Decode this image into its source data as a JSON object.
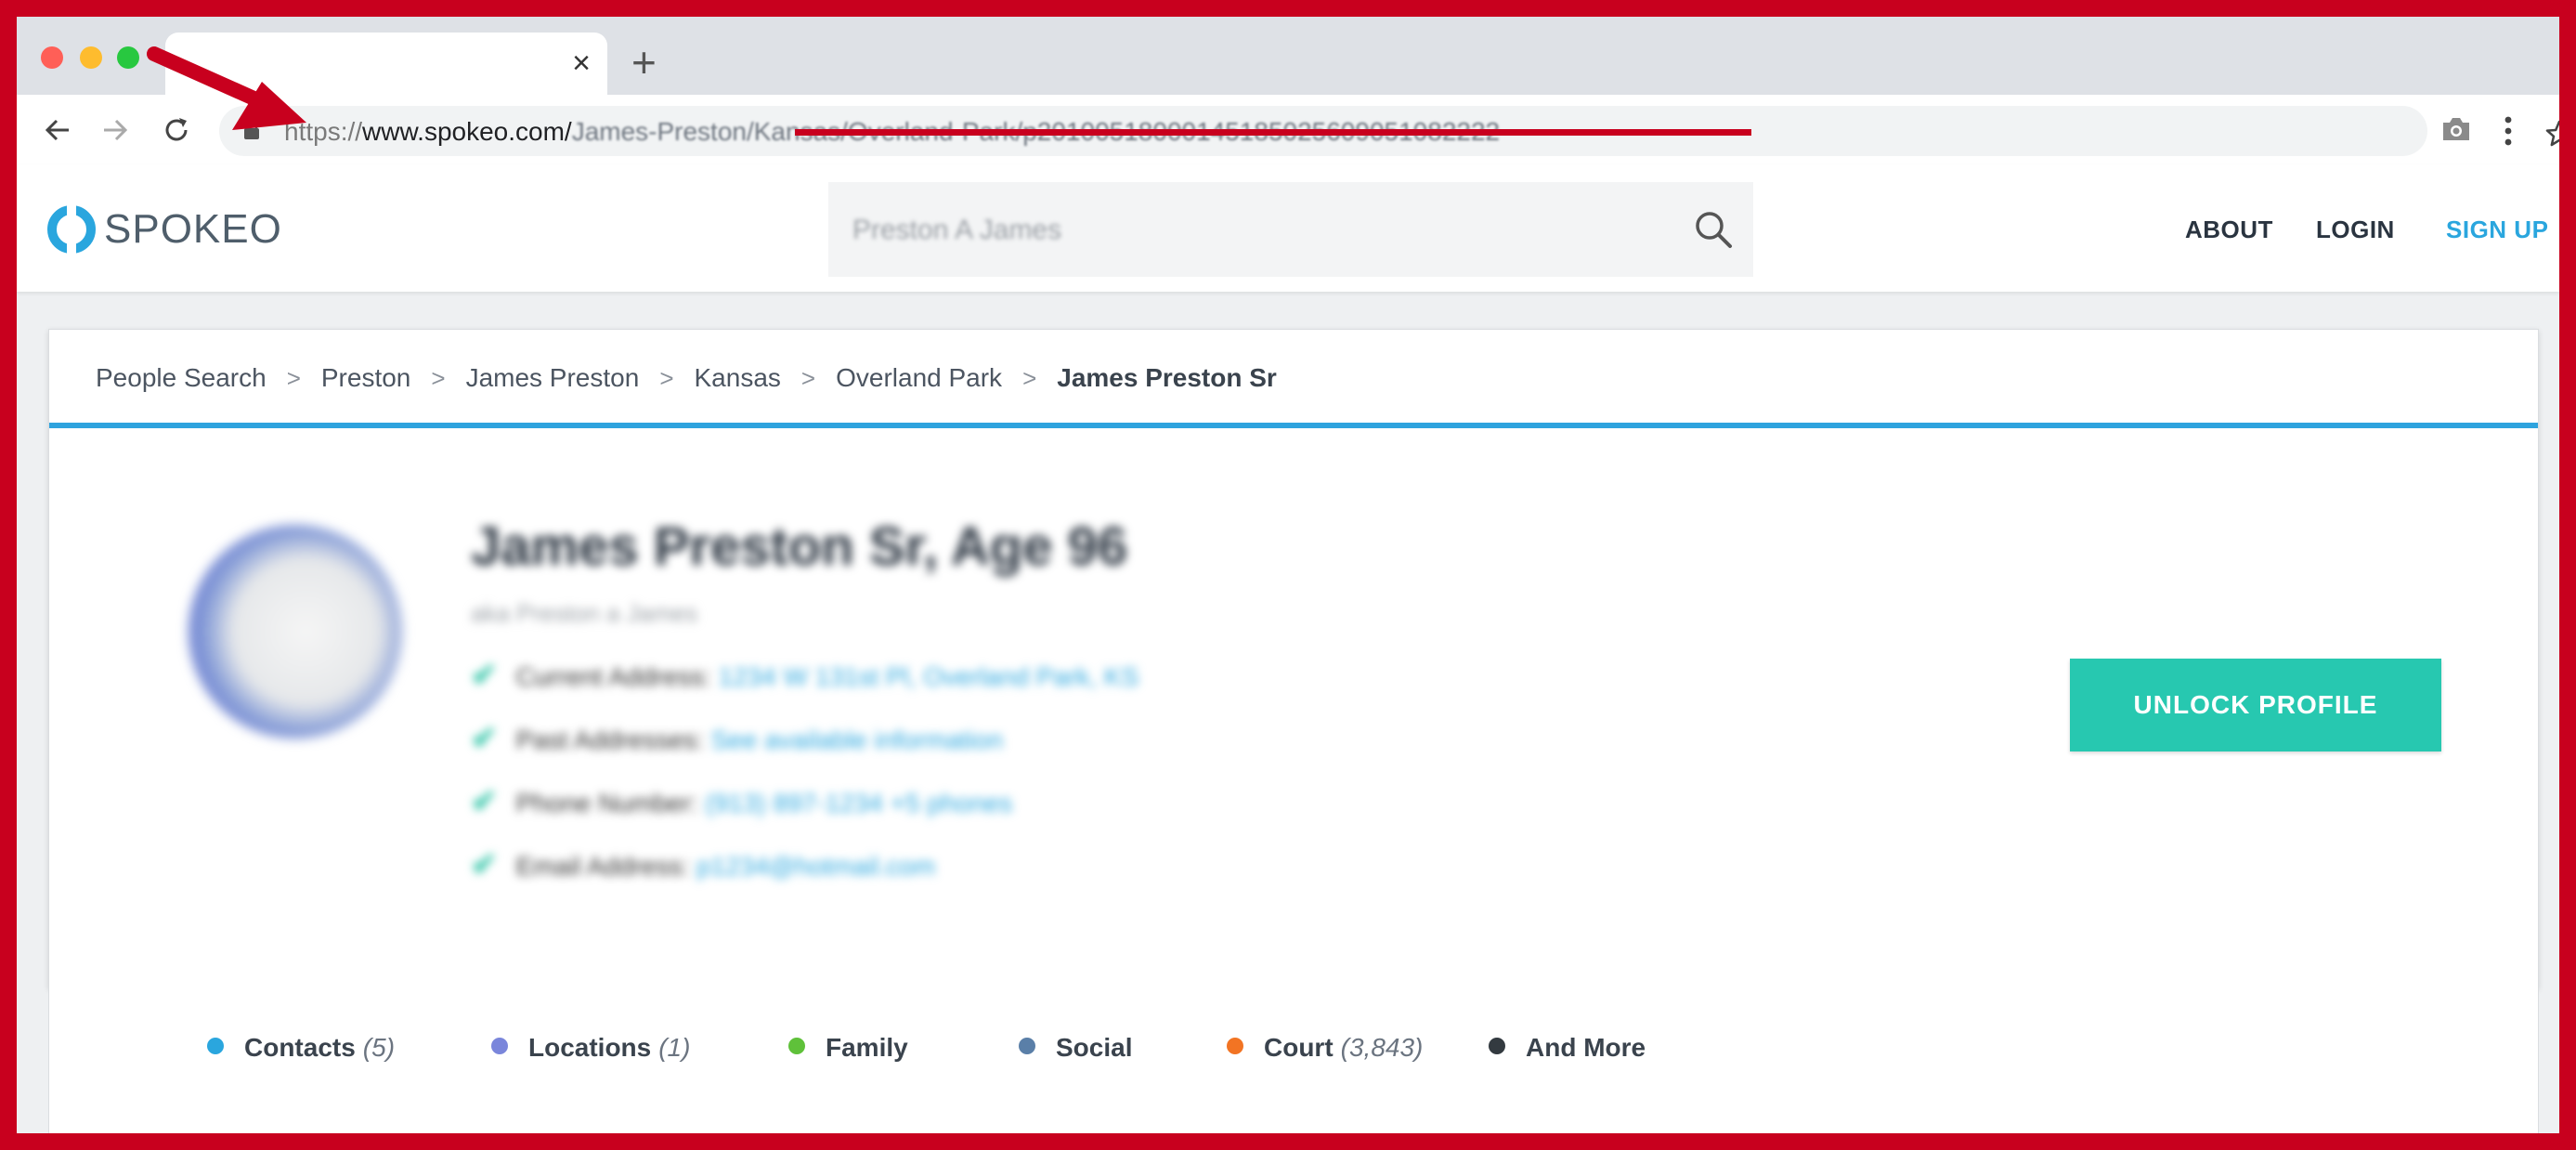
{
  "browser": {
    "tab_close": "×",
    "new_tab": "+",
    "url_scheme": "https://",
    "url_host": "www.spokeo.com/",
    "url_path": "James-Preston/Kansas/Overland-Park/p20100518000145185025609051082222"
  },
  "site": {
    "logo": "SPOKEO",
    "search_value": "Preston A James",
    "nav": {
      "about": "ABOUT",
      "login": "LOGIN",
      "signup": "SIGN UP"
    }
  },
  "breadcrumb": {
    "items": [
      "People Search",
      "Preston",
      "James Preston",
      "Kansas",
      "Overland Park"
    ],
    "current": "James Preston Sr",
    "separator": ">"
  },
  "profile": {
    "name": "James Preston Sr, Age 96",
    "aka": "aka Preston a James",
    "facts": [
      {
        "label": "Current Address:",
        "value": "1234 W 131st Pl, Overland Park, KS"
      },
      {
        "label": "Past Addresses:",
        "value": "See available information"
      },
      {
        "label": "Phone Number:",
        "value": "(913) 897-1234 +5 phones"
      },
      {
        "label": "Email Address:",
        "value": "p1234@hotmail.com"
      }
    ],
    "check": "✔",
    "unlock_label": "UNLOCK PROFILE"
  },
  "sections": [
    {
      "label": "Contacts",
      "count": "(5)",
      "color": "#2aa6de"
    },
    {
      "label": "Locations",
      "count": "(1)",
      "color": "#7a86db"
    },
    {
      "label": "Family",
      "count": "",
      "color": "#5fc13a"
    },
    {
      "label": "Social",
      "count": "",
      "color": "#5a7fa8"
    },
    {
      "label": "Court",
      "count": "(3,843)",
      "color": "#f27423"
    },
    {
      "label": "And More",
      "count": "",
      "color": "#333a40"
    }
  ],
  "colors": {
    "frame": "#c8001e",
    "accent": "#2aa6de",
    "unlock": "#27c8b0"
  }
}
